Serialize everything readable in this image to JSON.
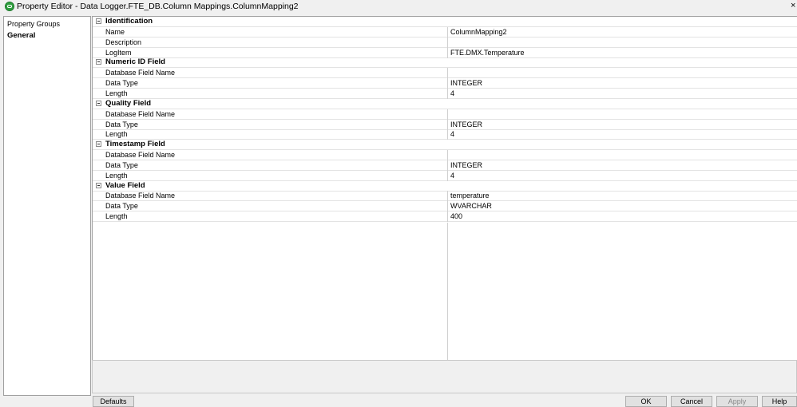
{
  "window": {
    "title": "Property Editor - Data Logger.FTE_DB.Column Mappings.ColumnMapping2",
    "close_glyph": "×"
  },
  "groups": {
    "header": "Property Groups",
    "selected": "General"
  },
  "grid": {
    "sections": [
      {
        "title": "Identification",
        "rows": [
          {
            "name": "Name",
            "value": "ColumnMapping2"
          },
          {
            "name": "Description",
            "value": ""
          },
          {
            "name": "LogItem",
            "value": "FTE.DMX.Temperature"
          }
        ]
      },
      {
        "title": "Numeric ID Field",
        "rows": [
          {
            "name": "Database Field Name",
            "value": ""
          },
          {
            "name": "Data Type",
            "value": "INTEGER"
          },
          {
            "name": "Length",
            "value": "4"
          }
        ]
      },
      {
        "title": "Quality Field",
        "rows": [
          {
            "name": "Database Field Name",
            "value": ""
          },
          {
            "name": "Data Type",
            "value": "INTEGER"
          },
          {
            "name": "Length",
            "value": "4"
          }
        ]
      },
      {
        "title": "Timestamp Field",
        "rows": [
          {
            "name": "Database Field Name",
            "value": ""
          },
          {
            "name": "Data Type",
            "value": "INTEGER"
          },
          {
            "name": "Length",
            "value": "4"
          }
        ]
      },
      {
        "title": "Value Field",
        "rows": [
          {
            "name": "Database Field Name",
            "value": "temperature"
          },
          {
            "name": "Data Type",
            "value": "WVARCHAR"
          },
          {
            "name": "Length",
            "value": "400"
          }
        ]
      }
    ]
  },
  "buttons": {
    "defaults": "Defaults",
    "ok": "OK",
    "cancel": "Cancel",
    "apply": "Apply",
    "help": "Help"
  }
}
